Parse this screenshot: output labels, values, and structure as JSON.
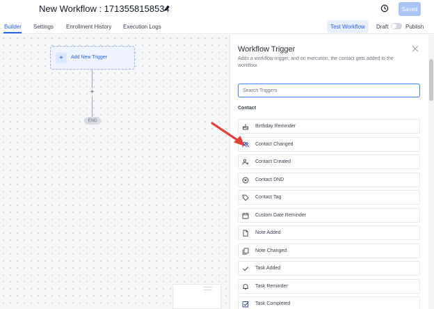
{
  "header": {
    "workflow_title": "New Workflow : 1713558158534",
    "saved_label": "Saved"
  },
  "tabs": [
    {
      "label": "Builder",
      "active": true
    },
    {
      "label": "Settings",
      "active": false
    },
    {
      "label": "Enrollment History",
      "active": false
    },
    {
      "label": "Execution Logs",
      "active": false
    }
  ],
  "toolbar": {
    "test_workflow_label": "Test Workflow",
    "draft_label": "Draft",
    "publish_label": "Publish",
    "publish_enabled": false
  },
  "canvas": {
    "add_trigger_label": "Add New Trigger",
    "add_step_symbol": "+",
    "end_label": "END"
  },
  "panel": {
    "title": "Workflow Trigger",
    "description": "Adds a workflow trigger, and on execution, the contact gets added to the workflow.",
    "search_placeholder": "Search Triggers",
    "section_label": "Contact",
    "triggers": [
      {
        "label": "Birthday Reminder",
        "icon": "cake-icon"
      },
      {
        "label": "Contact Changed",
        "icon": "users-icon"
      },
      {
        "label": "Contact Created",
        "icon": "user-plus-icon"
      },
      {
        "label": "Contact DND",
        "icon": "x-circle-icon"
      },
      {
        "label": "Contact Tag",
        "icon": "tag-icon"
      },
      {
        "label": "Custom Date Reminder",
        "icon": "calendar-icon"
      },
      {
        "label": "Note Added",
        "icon": "document-icon"
      },
      {
        "label": "Note Changed",
        "icon": "documents-icon"
      },
      {
        "label": "Task Added",
        "icon": "check-icon"
      },
      {
        "label": "Task Reminder",
        "icon": "bell-icon"
      },
      {
        "label": "Task Completed",
        "icon": "check-square-icon"
      }
    ]
  },
  "colors": {
    "accent": "#2563eb",
    "saved_button": "#a9c4f5",
    "annotation_arrow": "#e0413a"
  }
}
